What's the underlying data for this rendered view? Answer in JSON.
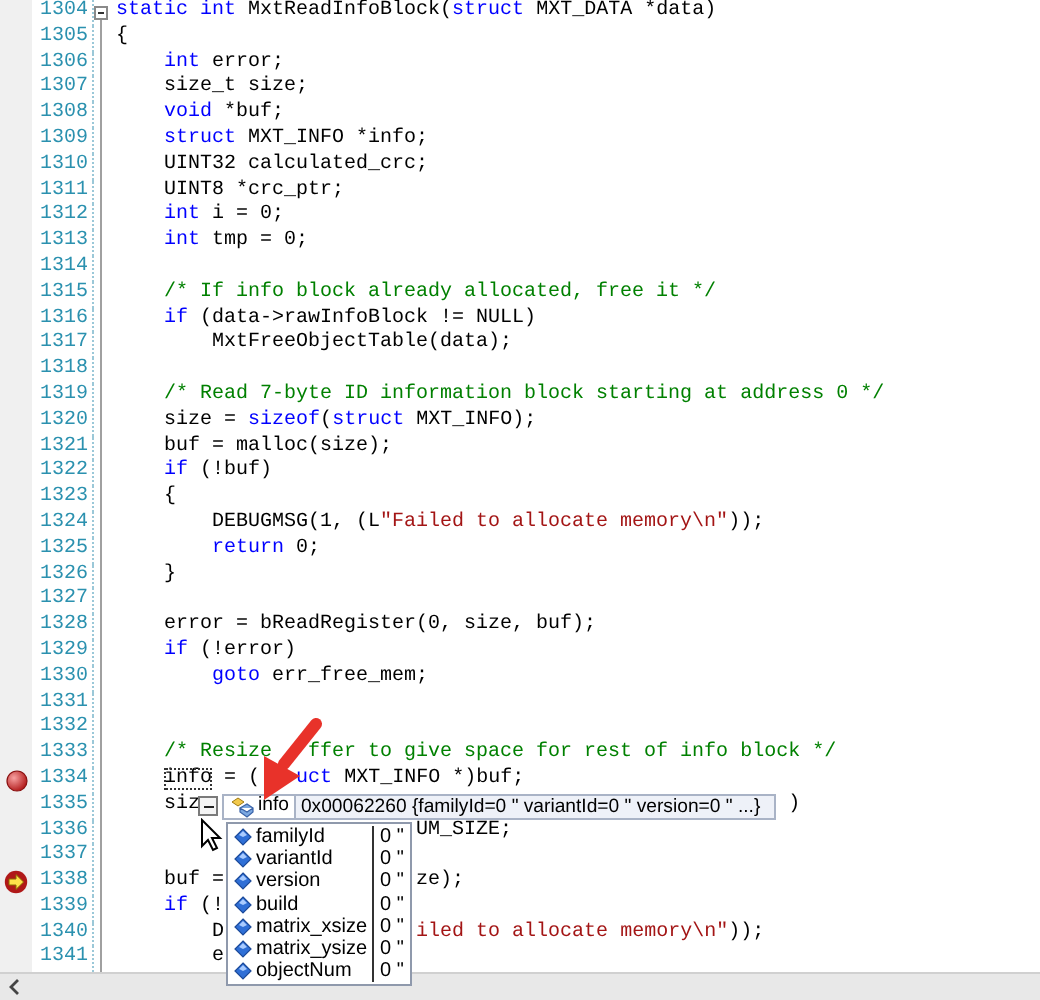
{
  "editor": {
    "lines": [
      {
        "number": "1304",
        "breakpoint": false,
        "current": false,
        "fold": true,
        "segments": [
          [
            {
              "kind": "keyword",
              "text": "static int"
            },
            {
              "kind": "plain",
              "text": " MxtReadInfoBlock("
            },
            {
              "kind": "keyword",
              "text": "struct"
            },
            {
              "kind": "plain",
              "text": " MXT_DATA *data)"
            }
          ]
        ]
      },
      {
        "number": "1305",
        "breakpoint": false,
        "current": false,
        "fold": false,
        "segments": [
          [
            {
              "kind": "plain",
              "text": "{"
            }
          ]
        ]
      },
      {
        "number": "1306",
        "breakpoint": false,
        "current": false,
        "fold": false,
        "segments": [
          [
            {
              "kind": "keyword",
              "text": "    int"
            },
            {
              "kind": "plain",
              "text": " error;"
            }
          ]
        ]
      },
      {
        "number": "1307",
        "breakpoint": false,
        "current": false,
        "fold": false,
        "segments": [
          [
            {
              "kind": "plain",
              "text": "    size_t size;"
            }
          ]
        ]
      },
      {
        "number": "1308",
        "breakpoint": false,
        "current": false,
        "fold": false,
        "segments": [
          [
            {
              "kind": "keyword",
              "text": "    void"
            },
            {
              "kind": "plain",
              "text": " *buf;"
            }
          ]
        ]
      },
      {
        "number": "1309",
        "breakpoint": false,
        "current": false,
        "fold": false,
        "segments": [
          [
            {
              "kind": "keyword",
              "text": "    struct"
            },
            {
              "kind": "plain",
              "text": " MXT_INFO *info;"
            }
          ]
        ]
      },
      {
        "number": "1310",
        "breakpoint": false,
        "current": false,
        "fold": false,
        "segments": [
          [
            {
              "kind": "plain",
              "text": "    UINT32 calculated_crc;"
            }
          ]
        ]
      },
      {
        "number": "1311",
        "breakpoint": false,
        "current": false,
        "fold": false,
        "segments": [
          [
            {
              "kind": "plain",
              "text": "    UINT8 *crc_ptr;"
            }
          ]
        ]
      },
      {
        "number": "1312",
        "breakpoint": false,
        "current": false,
        "fold": false,
        "segments": [
          [
            {
              "kind": "keyword",
              "text": "    int"
            },
            {
              "kind": "plain",
              "text": " i = 0;"
            }
          ]
        ]
      },
      {
        "number": "1313",
        "breakpoint": false,
        "current": false,
        "fold": false,
        "segments": [
          [
            {
              "kind": "keyword",
              "text": "    int"
            },
            {
              "kind": "plain",
              "text": " tmp = 0;"
            }
          ]
        ]
      },
      {
        "number": "1314",
        "breakpoint": false,
        "current": false,
        "fold": false
      },
      {
        "number": "1315",
        "breakpoint": false,
        "current": false,
        "fold": false,
        "segments": [
          [
            {
              "kind": "comment",
              "text": "    /* If info block already allocated, free it */"
            }
          ]
        ]
      },
      {
        "number": "1316",
        "breakpoint": false,
        "current": false,
        "fold": false,
        "segments": [
          [
            {
              "kind": "keyword",
              "text": "    if"
            },
            {
              "kind": "plain",
              "text": " (data->rawInfoBlock != NULL)"
            }
          ]
        ]
      },
      {
        "number": "1317",
        "breakpoint": false,
        "current": false,
        "fold": false,
        "segments": [
          [
            {
              "kind": "plain",
              "text": "        MxtFreeObjectTable(data);"
            }
          ]
        ]
      },
      {
        "number": "1318",
        "breakpoint": false,
        "current": false,
        "fold": false
      },
      {
        "number": "1319",
        "breakpoint": false,
        "current": false,
        "fold": false,
        "segments": [
          [
            {
              "kind": "comment",
              "text": "    /* Read 7-byte ID information block starting at address 0 */"
            }
          ]
        ]
      },
      {
        "number": "1320",
        "breakpoint": false,
        "current": false,
        "fold": false,
        "segments": [
          [
            {
              "kind": "plain",
              "text": "    size = "
            },
            {
              "kind": "keyword",
              "text": "sizeof"
            },
            {
              "kind": "plain",
              "text": "("
            },
            {
              "kind": "keyword",
              "text": "struct"
            },
            {
              "kind": "plain",
              "text": " MXT_INFO);"
            }
          ]
        ]
      },
      {
        "number": "1321",
        "breakpoint": false,
        "current": false,
        "fold": false,
        "segments": [
          [
            {
              "kind": "plain",
              "text": "    buf = malloc(size);"
            }
          ]
        ]
      },
      {
        "number": "1322",
        "breakpoint": false,
        "current": false,
        "fold": false,
        "segments": [
          [
            {
              "kind": "keyword",
              "text": "    if"
            },
            {
              "kind": "plain",
              "text": " (!buf)"
            }
          ]
        ]
      },
      {
        "number": "1323",
        "breakpoint": false,
        "current": false,
        "fold": false,
        "segments": [
          [
            {
              "kind": "plain",
              "text": "    {"
            }
          ]
        ]
      },
      {
        "number": "1324",
        "breakpoint": false,
        "current": false,
        "fold": false,
        "segments": [
          [
            {
              "kind": "plain",
              "text": "        DEBUGMSG(1, (L"
            },
            {
              "kind": "string",
              "text": "\"Failed to allocate memory\\n\""
            },
            {
              "kind": "plain",
              "text": "));"
            }
          ]
        ]
      },
      {
        "number": "1325",
        "breakpoint": false,
        "current": false,
        "fold": false,
        "segments": [
          [
            {
              "kind": "keyword",
              "text": "        return"
            },
            {
              "kind": "plain",
              "text": " 0;"
            }
          ]
        ]
      },
      {
        "number": "1326",
        "breakpoint": false,
        "current": false,
        "fold": false,
        "segments": [
          [
            {
              "kind": "plain",
              "text": "    }"
            }
          ]
        ]
      },
      {
        "number": "1327",
        "breakpoint": false,
        "current": false,
        "fold": false
      },
      {
        "number": "1328",
        "breakpoint": false,
        "current": false,
        "fold": false,
        "segments": [
          [
            {
              "kind": "plain",
              "text": "    error = bReadRegister(0, size, buf);"
            }
          ]
        ]
      },
      {
        "number": "1329",
        "breakpoint": false,
        "current": false,
        "fold": false,
        "segments": [
          [
            {
              "kind": "keyword",
              "text": "    if"
            },
            {
              "kind": "plain",
              "text": " (!error)"
            }
          ]
        ]
      },
      {
        "number": "1330",
        "breakpoint": false,
        "current": false,
        "fold": false,
        "segments": [
          [
            {
              "kind": "keyword",
              "text": "        goto"
            },
            {
              "kind": "plain",
              "text": " err_free_mem;"
            }
          ]
        ]
      },
      {
        "number": "1331",
        "breakpoint": false,
        "current": false,
        "fold": false
      },
      {
        "number": "1332",
        "breakpoint": false,
        "current": false,
        "fold": false
      },
      {
        "number": "1333",
        "breakpoint": false,
        "current": false,
        "fold": false,
        "segments": [
          [
            {
              "kind": "comment",
              "text": "    /* Resize   ffer to give space for rest of info block */"
            }
          ]
        ]
      },
      {
        "number": "1334",
        "breakpoint": true,
        "current": false,
        "fold": false,
        "segments": [
          [
            {
              "kind": "focus",
              "text": "    info"
            },
            {
              "kind": "plain",
              "text": " = ("
            },
            {
              "kind": "keyword",
              "text": "   uct"
            },
            {
              "kind": "plain",
              "text": " MXT_INFO *)buf;"
            }
          ]
        ]
      },
      {
        "number": "1335",
        "breakpoint": false,
        "current": false,
        "fold": false,
        "segments": [
          [
            {
              "kind": "plain",
              "text": "    siz"
            }
          ],
          [
            {
              "kind": "plain",
              "text": "                                                 )"
            }
          ]
        ]
      },
      {
        "number": "1336",
        "breakpoint": false,
        "current": false,
        "fold": false,
        "segments": [
          [
            {
              "kind": "plain",
              "text": "                         UM_SIZE;"
            }
          ]
        ]
      },
      {
        "number": "1337",
        "breakpoint": false,
        "current": false,
        "fold": false
      },
      {
        "number": "1338",
        "breakpoint": false,
        "current": true,
        "fold": false,
        "segments": [
          [
            {
              "kind": "plain",
              "text": "    buf ="
            }
          ],
          [
            {
              "kind": "plain",
              "text": "                ze);"
            }
          ]
        ]
      },
      {
        "number": "1339",
        "breakpoint": false,
        "current": false,
        "fold": false,
        "segments": [
          [
            {
              "kind": "keyword",
              "text": "    if"
            },
            {
              "kind": "plain",
              "text": " (!"
            }
          ]
        ]
      },
      {
        "number": "1340",
        "breakpoint": false,
        "current": false,
        "fold": false,
        "segments": [
          [
            {
              "kind": "plain",
              "text": "        D"
            }
          ],
          [
            {
              "kind": "string",
              "text": "                iled to allocate memory\\n\""
            },
            {
              "kind": "plain",
              "text": "));"
            }
          ]
        ]
      },
      {
        "number": "1341",
        "breakpoint": false,
        "current": false,
        "fold": false,
        "segments": [
          [
            {
              "kind": "plain",
              "text": "        e"
            }
          ]
        ]
      }
    ]
  },
  "datatip": {
    "expanded": true,
    "name": "info",
    "value": "0x00062260 {familyId=0 \" variantId=0 \" version=0 \" ...}",
    "members": [
      {
        "name": "familyId",
        "value": "0 \""
      },
      {
        "name": "variantId",
        "value": "0 \""
      },
      {
        "name": "version",
        "value": "0 \""
      },
      {
        "name": "build",
        "value": "0 \""
      },
      {
        "name": "matrix_xsize",
        "value": "0 \""
      },
      {
        "name": "matrix_ysize",
        "value": "0 \""
      },
      {
        "name": "objectNum",
        "value": "0 \""
      }
    ]
  }
}
